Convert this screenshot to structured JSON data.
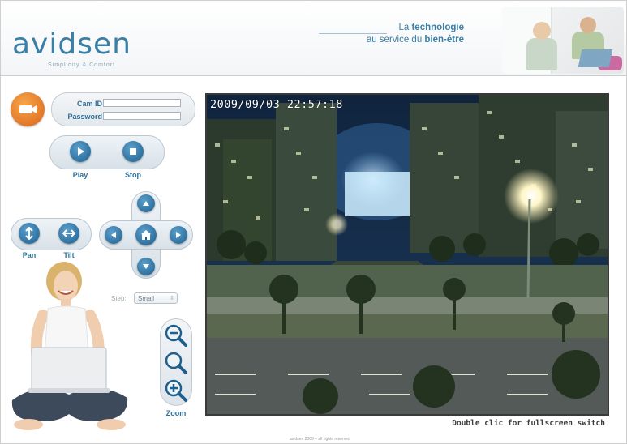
{
  "header": {
    "logo": "avidsen",
    "logo_sub": "Simplicity & Comfort",
    "tagline_line1_prefix": "La",
    "tagline_line1_bold": "technologie",
    "tagline_line2_prefix": "au service du",
    "tagline_line2_bold": "bien-être"
  },
  "login": {
    "cam_id_label": "Cam ID",
    "password_label": "Password",
    "cam_id_value": "",
    "password_value": ""
  },
  "playback": {
    "play_label": "Play",
    "stop_label": "Stop"
  },
  "ptz": {
    "pan_label": "Pan",
    "tilt_label": "Tilt",
    "step_label": "Step:",
    "step_value": "Small",
    "zoom_label": "Zoom"
  },
  "video": {
    "timestamp": "2009/09/03 22:57:18",
    "fullscreen_hint": "Double clic for fullscreen switch"
  },
  "footer": {
    "text": "avidsen 2009 – all rights reserved"
  },
  "colors": {
    "brand": "#3b7fa6",
    "button_blue": "#1e5f8d",
    "login_orange": "#e07a2a"
  }
}
